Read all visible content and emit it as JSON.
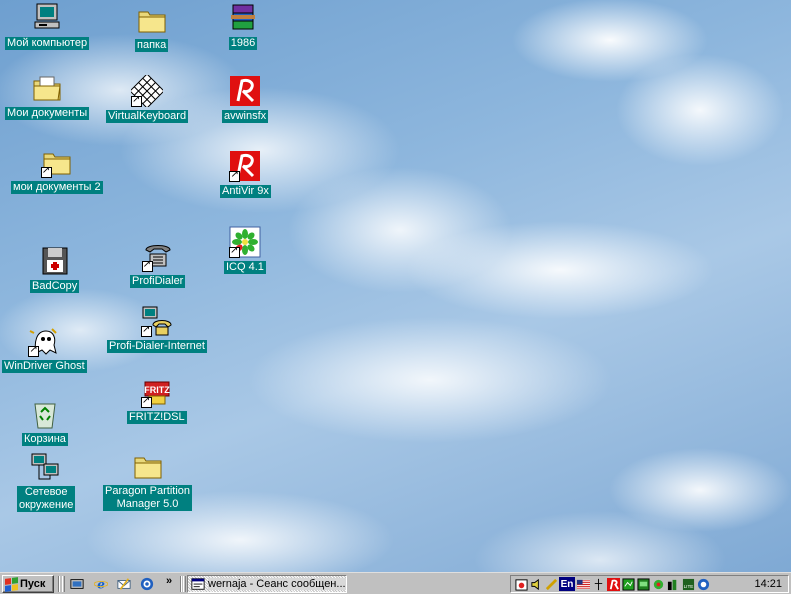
{
  "desktop": {
    "icons": [
      {
        "label": "Мой компьютер",
        "icon": "my-computer-icon"
      },
      {
        "label": "Мои документы",
        "icon": "my-documents-icon"
      },
      {
        "label": "мои документы 2",
        "icon": "folder-shortcut-icon"
      },
      {
        "label": "BadCopy",
        "icon": "floppy-disk-icon"
      },
      {
        "label": "WinDriver Ghost",
        "icon": "ghost-icon"
      },
      {
        "label": "Корзина",
        "icon": "recycle-bin-icon"
      },
      {
        "label": "Сетевое\nокружение",
        "icon": "network-neighborhood-icon"
      },
      {
        "label": "папка",
        "icon": "folder-icon"
      },
      {
        "label": "VirtualKeyboard",
        "icon": "keyboard-icon"
      },
      {
        "label": "ProfiDialer",
        "icon": "telephone-icon"
      },
      {
        "label": "Profi-Dialer-Internet",
        "icon": "telephone-computer-icon"
      },
      {
        "label": "FRITZ!DSL",
        "icon": "fritz-icon"
      },
      {
        "label": "Paragon Partition\nManager 5.0",
        "icon": "folder-icon"
      },
      {
        "label": "1986",
        "icon": "winrar-icon"
      },
      {
        "label": "avwinsfx",
        "icon": "antivir-icon"
      },
      {
        "label": "AntiVir 9x",
        "icon": "antivir-shortcut-icon"
      },
      {
        "label": "ICQ 4.1",
        "icon": "icq-flower-icon"
      }
    ]
  },
  "taskbar": {
    "start_label": "Пуск",
    "quick_launch": [
      "show-desktop-icon",
      "internet-explorer-icon",
      "outlook-express-icon",
      "channels-icon"
    ],
    "more": "»",
    "task_button": {
      "label": "wernaja - Сеанс сообщен...",
      "icon": "message-window-icon"
    },
    "tray": {
      "language": "En",
      "icons": [
        "scheduler-icon",
        "volume-icon",
        "language-en-icon",
        "us-flag-icon",
        "modem-icon",
        "antivir-icon",
        "network-icon",
        "network-activity-icon",
        "icq-icon",
        "meter-icon",
        "lite-icon",
        "monitor-icon"
      ],
      "clock": "14:21"
    }
  }
}
